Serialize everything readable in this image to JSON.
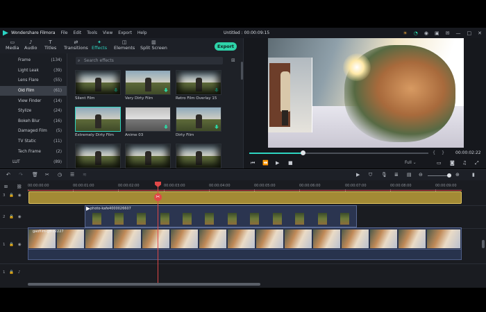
{
  "window": {
    "app_name": "Wondershare Filmora",
    "document_title": "Untitled : 00:00:09:15",
    "menu": [
      "File",
      "Edit",
      "Tools",
      "View",
      "Export",
      "Help"
    ]
  },
  "toolbar": {
    "modules": [
      "Media",
      "Audio",
      "Titles",
      "Transitions",
      "Effects",
      "Elements",
      "Split Screen"
    ],
    "active_module": "Effects",
    "export_label": "Export",
    "accent_color": "#2ed6c2"
  },
  "sidebar": {
    "categories": [
      {
        "label": "Frame",
        "count": "(134)"
      },
      {
        "label": "Light Leak",
        "count": "(39)"
      },
      {
        "label": "Lens Flare",
        "count": "(55)"
      },
      {
        "label": "Old Film",
        "count": "(61)"
      },
      {
        "label": "View Finder",
        "count": "(14)"
      },
      {
        "label": "Stylize",
        "count": "(24)"
      },
      {
        "label": "Bokeh Blur",
        "count": "(16)"
      },
      {
        "label": "Damaged Film",
        "count": "(5)"
      },
      {
        "label": "TV Static",
        "count": "(11)"
      },
      {
        "label": "Tech Frame",
        "count": "(2)"
      },
      {
        "label": "LUT",
        "count": "(89)"
      }
    ],
    "selected": "Old Film"
  },
  "effects": {
    "search_placeholder": "Search effects",
    "items": [
      {
        "label": "Silent Film",
        "selected": false
      },
      {
        "label": "Very Dirty Film",
        "selected": false
      },
      {
        "label": "Retro Film Overlay 15",
        "selected": false
      },
      {
        "label": "Extremely Dirty Film",
        "selected": true
      },
      {
        "label": "Anime 03",
        "selected": false
      },
      {
        "label": "Dirty Film",
        "selected": false
      },
      {
        "label": "",
        "selected": false
      },
      {
        "label": "",
        "selected": false
      },
      {
        "label": "",
        "selected": false
      }
    ]
  },
  "preview": {
    "current_time": "00:00:02:22",
    "progress": 0.3,
    "quality": "Full"
  },
  "timeline": {
    "ruler": [
      "00:00:00:00",
      "00:00:01:00",
      "00:00:02:00",
      "00:00:03:00",
      "00:00:04:00",
      "00:00:05:00",
      "00:00:06:00",
      "00:00:07:00",
      "00:00:08:00",
      "00:00:09:00"
    ],
    "tracks": [
      {
        "label": "3"
      },
      {
        "label": "2"
      },
      {
        "label": "1"
      },
      {
        "label": "1"
      }
    ],
    "clip_track2_label": "photo-kafe4000026607",
    "clip_track1_label": "gaofilm-gd-22227"
  }
}
